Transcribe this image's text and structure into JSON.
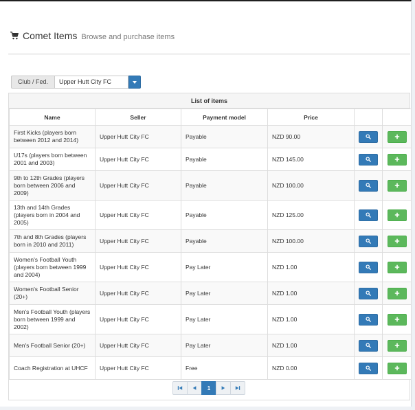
{
  "header": {
    "title": "Comet Items",
    "subtitle": "Browse and purchase items",
    "icon": "shopping-cart-icon"
  },
  "filter": {
    "label": "Club / Fed.",
    "selected": "Upper Hutt City FC"
  },
  "table": {
    "heading": "List of items",
    "columns": [
      "Name",
      "Seller",
      "Payment model",
      "Price",
      "",
      ""
    ],
    "rows": [
      {
        "name": "First Kicks (players born between 2012 and 2014)",
        "seller": "Upper Hutt City FC",
        "payment": "Payable",
        "price": "NZD 90.00"
      },
      {
        "name": "U17s (players born between 2001 and 2003)",
        "seller": "Upper Hutt City FC",
        "payment": "Payable",
        "price": "NZD 145.00"
      },
      {
        "name": "9th to 12th Grades (players born between 2006 and 2009)",
        "seller": "Upper Hutt City FC",
        "payment": "Payable",
        "price": "NZD 100.00"
      },
      {
        "name": "13th and 14th Grades (players born in 2004 and 2005)",
        "seller": "Upper Hutt City FC",
        "payment": "Payable",
        "price": "NZD 125.00"
      },
      {
        "name": "7th and 8th Grades (players born in 2010 and 2011)",
        "seller": "Upper Hutt City FC",
        "payment": "Payable",
        "price": "NZD 100.00"
      },
      {
        "name": "Women's Football Youth (players born between 1999 and 2004)",
        "seller": "Upper Hutt City FC",
        "payment": "Pay Later",
        "price": "NZD 1.00"
      },
      {
        "name": "Women's Football Senior (20+)",
        "seller": "Upper Hutt City FC",
        "payment": "Pay Later",
        "price": "NZD 1.00"
      },
      {
        "name": "Men's Football Youth (players born between 1999 and 2002)",
        "seller": "Upper Hutt City FC",
        "payment": "Pay Later",
        "price": "NZD 1.00"
      },
      {
        "name": "Men's Football Senior (20+)",
        "seller": "Upper Hutt City FC",
        "payment": "Pay Later",
        "price": "NZD 1.00"
      },
      {
        "name": "Coach Registration at UHCF",
        "seller": "Upper Hutt City FC",
        "payment": "Free",
        "price": "NZD 0.00"
      }
    ]
  },
  "pagination": {
    "current_page": "1",
    "icons": [
      "first-page-icon",
      "previous-page-icon",
      "next-page-icon",
      "last-page-icon"
    ]
  },
  "colors": {
    "primary": "#337ab7",
    "success": "#5cb85c"
  }
}
